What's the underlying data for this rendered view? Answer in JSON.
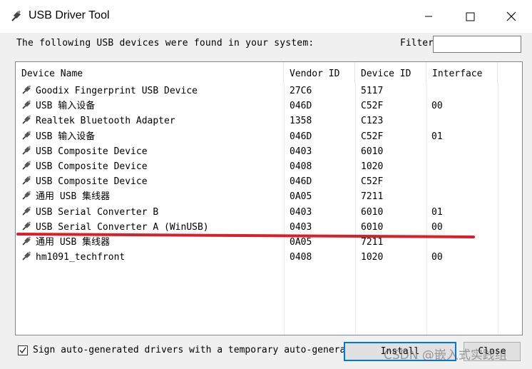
{
  "window": {
    "title": "USB Driver Tool",
    "minimize_icon": "minimize-icon",
    "maximize_icon": "maximize-icon",
    "close_icon": "close-icon"
  },
  "header": {
    "description": "The following USB devices were found in your system:",
    "filter_label": "Filter",
    "filter_value": ""
  },
  "table": {
    "columns": [
      "Device Name",
      "Vendor ID",
      "Device ID",
      "Interface"
    ],
    "rows": [
      {
        "name": "Goodix Fingerprint USB Device",
        "vendor": "27C6",
        "device": "5117",
        "interface": ""
      },
      {
        "name": "USB 输入设备",
        "vendor": "046D",
        "device": "C52F",
        "interface": "00"
      },
      {
        "name": "Realtek Bluetooth Adapter",
        "vendor": "1358",
        "device": "C123",
        "interface": ""
      },
      {
        "name": "USB 输入设备",
        "vendor": "046D",
        "device": "C52F",
        "interface": "01"
      },
      {
        "name": "USB Composite Device",
        "vendor": "0403",
        "device": "6010",
        "interface": ""
      },
      {
        "name": "USB Composite Device",
        "vendor": "0408",
        "device": "1020",
        "interface": ""
      },
      {
        "name": "USB Composite Device",
        "vendor": "046D",
        "device": "C52F",
        "interface": ""
      },
      {
        "name": "通用 USB 集线器",
        "vendor": "0A05",
        "device": "7211",
        "interface": ""
      },
      {
        "name": "USB Serial Converter B",
        "vendor": "0403",
        "device": "6010",
        "interface": "01"
      },
      {
        "name": "USB Serial Converter A (WinUSB)",
        "vendor": "0403",
        "device": "6010",
        "interface": "00"
      },
      {
        "name": "通用 USB 集线器",
        "vendor": "0A05",
        "device": "7211",
        "interface": ""
      },
      {
        "name": "hm1091_techfront",
        "vendor": "0408",
        "device": "1020",
        "interface": "00"
      }
    ],
    "row_icon": "usb-plug-icon"
  },
  "footer": {
    "checkbox_label": "Sign auto-generated drivers with a temporary auto-generated certificate",
    "checkbox_checked": true,
    "install_button": "Install",
    "close_button": "Close",
    "watermark": "CSDN @嵌入式实践组"
  },
  "colors": {
    "annotation_red": "#d8202a",
    "focus_blue": "#0078d7"
  }
}
